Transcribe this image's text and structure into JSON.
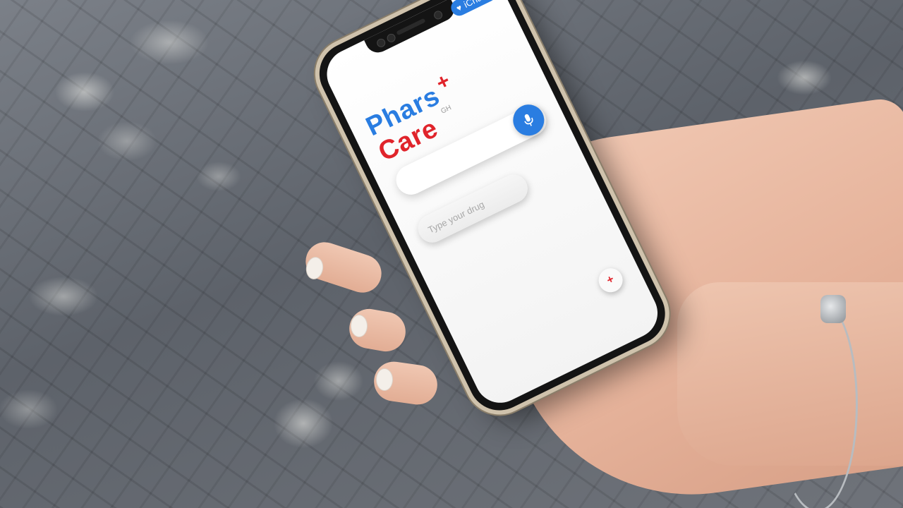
{
  "app": {
    "badge_label": "iChare",
    "badge_icon": "heart-icon",
    "logo": {
      "line1": "Phars",
      "plus": "+",
      "line2": "Care",
      "superscript": "GH"
    },
    "search": {
      "mic_icon": "microphone-icon"
    },
    "drug_input": {
      "placeholder": "Type your drug",
      "value": ""
    },
    "fab": {
      "label": "+",
      "icon": "plus-icon"
    }
  },
  "colors": {
    "brand_blue": "#2a7de1",
    "brand_red": "#e0242b",
    "screen_bg": "#f3f3f3"
  }
}
